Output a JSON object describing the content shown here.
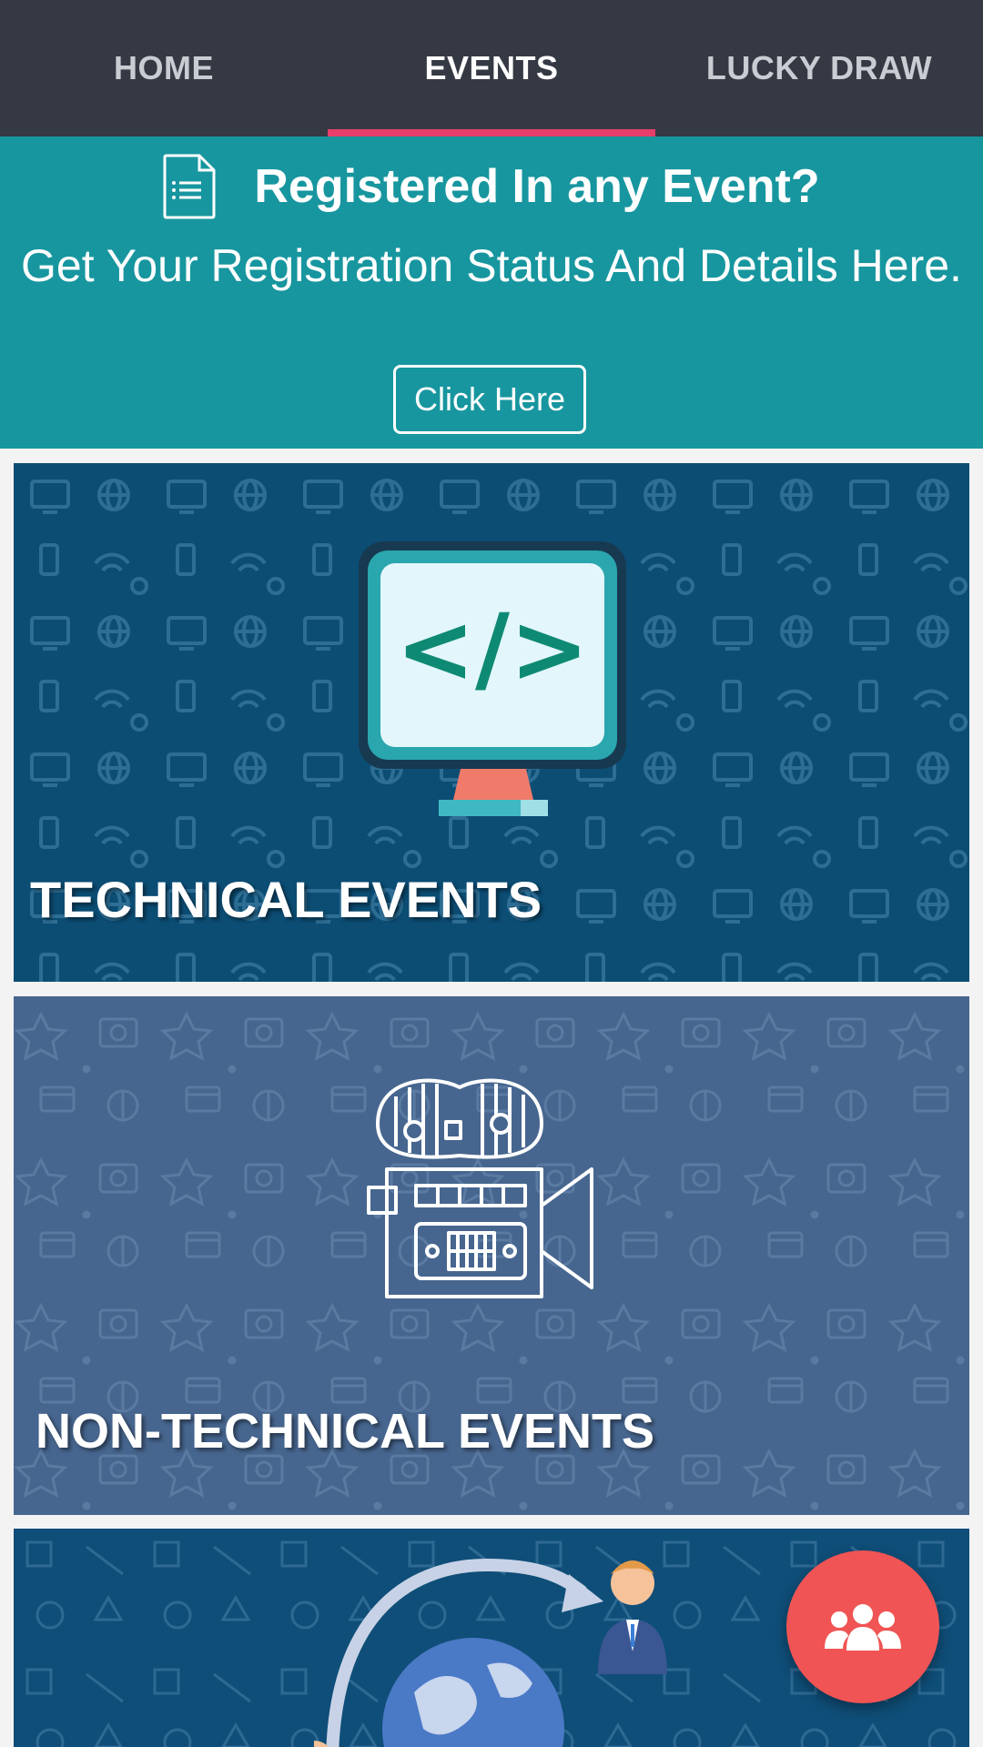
{
  "tabs": [
    {
      "label": "HOME",
      "active": false
    },
    {
      "label": "EVENTS",
      "active": true
    },
    {
      "label": "LUCKY DRAW",
      "active": false
    }
  ],
  "colors": {
    "toolbar": "#353943",
    "indicator": "#e83e6c",
    "banner": "#17969f",
    "technical_card": "#0c4d74",
    "non_technical_card": "#47668f",
    "third_card": "#0f4e78",
    "fab": "#f05454"
  },
  "banner": {
    "icon": "document-icon",
    "title": "Registered In any Event?",
    "subtitle": "Get Your Registration Status And Details Here.",
    "button_label": "Click Here"
  },
  "cards": [
    {
      "label": "TECHNICAL EVENTS",
      "icon": "code-monitor-icon"
    },
    {
      "label": "NON-TECHNICAL EVENTS",
      "icon": "movie-camera-icon"
    },
    {
      "label": "",
      "icon": "globe-people-icon"
    }
  ],
  "fab": {
    "icon": "group-icon"
  }
}
